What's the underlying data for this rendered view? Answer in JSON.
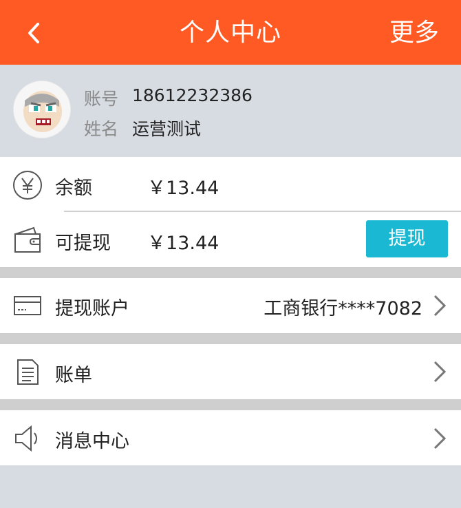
{
  "header": {
    "title": "个人中心",
    "more": "更多"
  },
  "profile": {
    "account_label": "账号",
    "account_value": "18612232386",
    "name_label": "姓名",
    "name_value": "运营测试"
  },
  "balance": {
    "label": "余额",
    "amount": "￥13.44"
  },
  "withdrawable": {
    "label": "可提现",
    "amount": "￥13.44",
    "button": "提现"
  },
  "withdraw_account": {
    "label": "提现账户",
    "value": "工商银行****7082"
  },
  "bill": {
    "label": "账单"
  },
  "messages": {
    "label": "消息中心"
  },
  "colors": {
    "header": "#ff5a24",
    "button": "#1ab8d2",
    "background": "#d7dbe2",
    "separator": "#cfcfcf"
  },
  "icons": [
    "chevron-left-icon",
    "avatar",
    "yen-icon",
    "wallet-icon",
    "card-icon",
    "bill-icon",
    "speaker-icon",
    "chevron-right-icon"
  ]
}
